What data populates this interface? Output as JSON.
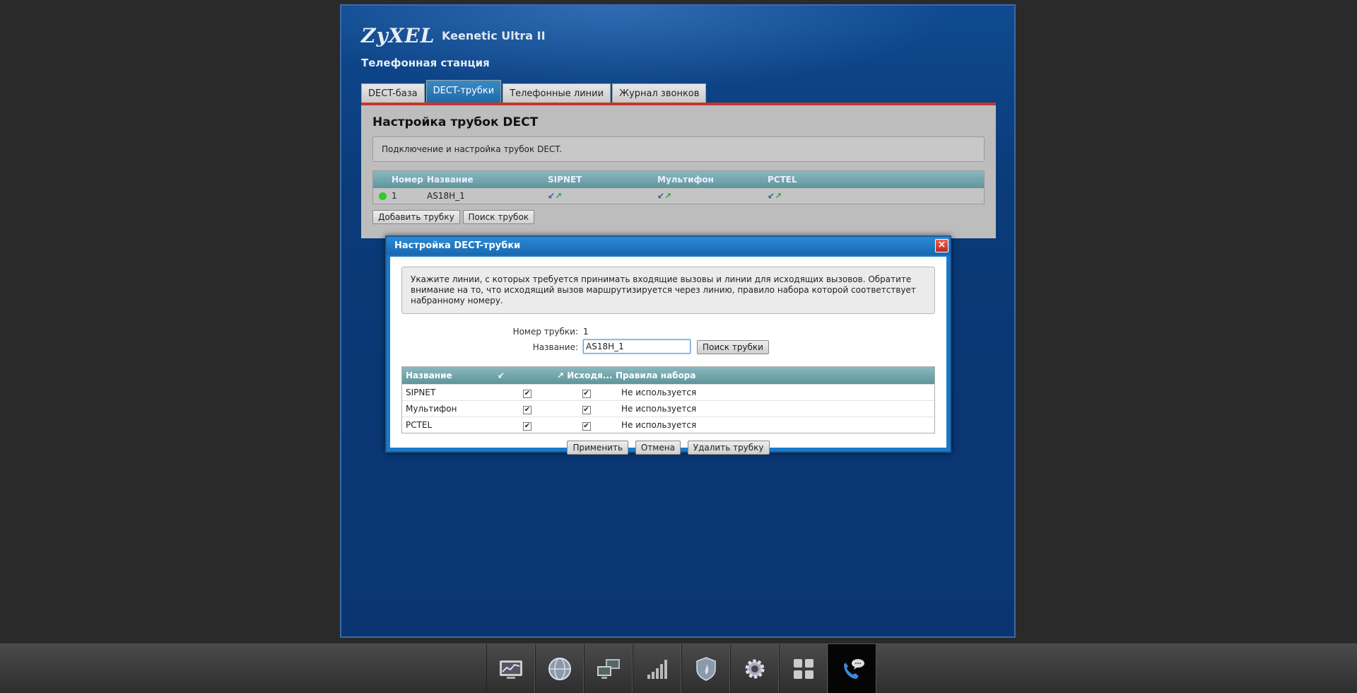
{
  "header": {
    "logo": "ZyXEL",
    "model": "Keenetic Ultra II",
    "section_title": "Телефонная станция"
  },
  "tabs": [
    {
      "label": "DECT-база",
      "active": false
    },
    {
      "label": "DECT-трубки",
      "active": true
    },
    {
      "label": "Телефонные линии",
      "active": false
    },
    {
      "label": "Журнал звонков",
      "active": false
    }
  ],
  "panel": {
    "title": "Настройка трубок DECT",
    "description": "Подключение и настройка трубок DECT.",
    "columns": [
      "Номер",
      "Название",
      "SIPNET",
      "Мультифон",
      "PCTEL"
    ],
    "rows": [
      {
        "status": "online",
        "number": "1",
        "name": "AS18H_1"
      }
    ],
    "add_button": "Добавить трубку",
    "search_button": "Поиск трубок"
  },
  "modal": {
    "title": "Настройка DECT-трубки",
    "info": "Укажите линии, с которых требуется принимать входящие вызовы и линии для исходящих вызовов. Обратите внимание на то, что исходящий вызов маршрутизируется через линию, правило набора которой соответствует набранному номеру.",
    "handset_number_label": "Номер трубки:",
    "handset_number": "1",
    "name_label": "Название:",
    "name_value": "AS18H_1",
    "search_button": "Поиск трубки",
    "columns": {
      "name": "Название",
      "incoming": "Входящие",
      "outgoing": "Исходя...",
      "dial_rules": "Правила набора"
    },
    "lines": [
      {
        "name": "SIPNET",
        "incoming": true,
        "outgoing": true,
        "dial_rule": "Не используется"
      },
      {
        "name": "Мультифон",
        "incoming": true,
        "outgoing": true,
        "dial_rule": "Не используется"
      },
      {
        "name": "PCTEL",
        "incoming": true,
        "outgoing": true,
        "dial_rule": "Не используется"
      }
    ],
    "apply_button": "Применить",
    "cancel_button": "Отмена",
    "delete_button": "Удалить трубку",
    "close_glyph": "×"
  },
  "taskbar": [
    {
      "icon": "monitor-chart-icon",
      "active": false
    },
    {
      "icon": "globe-icon",
      "active": false
    },
    {
      "icon": "network-computers-icon",
      "active": false
    },
    {
      "icon": "signal-bars-icon",
      "active": false
    },
    {
      "icon": "shield-icon",
      "active": false
    },
    {
      "icon": "gear-icon",
      "active": false
    },
    {
      "icon": "apps-grid-icon",
      "active": false
    },
    {
      "icon": "phone-chat-icon",
      "active": true
    }
  ],
  "colors": {
    "accent": "#1c7ac8",
    "tab_active": "#2a7ab8",
    "alert_red": "#c0392b",
    "status_online": "#2ecc2e"
  }
}
